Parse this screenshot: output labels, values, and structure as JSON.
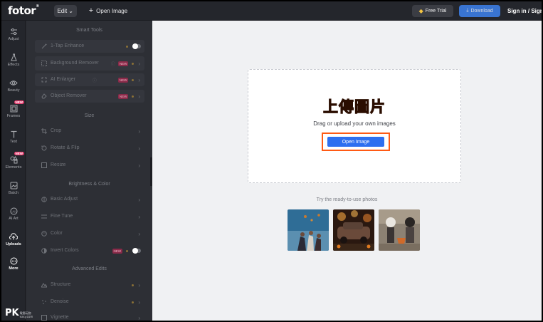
{
  "topbar": {
    "logo": "fotor",
    "logo_mark": "®",
    "edit_label": "Edit",
    "open_image_label": "Open Image",
    "free_trial_label": "Free Trial",
    "download_label": "Download",
    "signin_label": "Sign in / Sign up"
  },
  "rail": [
    {
      "label": "Adjust",
      "icon": "sliders-icon"
    },
    {
      "label": "Effects",
      "icon": "flask-icon"
    },
    {
      "label": "Beauty",
      "icon": "eye-icon"
    },
    {
      "label": "Frames",
      "icon": "frame-icon",
      "badge": "NEW"
    },
    {
      "label": "Text",
      "icon": "text-icon"
    },
    {
      "label": "Elements",
      "icon": "elements-icon",
      "badge": "NEW"
    },
    {
      "label": "Batch",
      "icon": "batch-icon"
    },
    {
      "label": "AI Art",
      "icon": "ai-icon"
    },
    {
      "label": "Uploads",
      "icon": "cloud-upload-icon"
    },
    {
      "label": "More",
      "icon": "more-icon"
    }
  ],
  "panel": {
    "sections": {
      "smart": "Smart Tools",
      "size": "Size",
      "brightness": "Brightness & Color",
      "advanced": "Advanced Edits"
    },
    "tools": {
      "one_tap": "1-Tap Enhance",
      "bg_remover": "Background Remover",
      "ai_enlarger": "AI Enlarger",
      "object_remover": "Object Remover",
      "crop": "Crop",
      "rotate": "Rotate & Flip",
      "resize": "Resize",
      "basic_adjust": "Basic Adjust",
      "fine_tune": "Fine Tune",
      "color": "Color",
      "invert": "Invert Colors",
      "structure": "Structure",
      "denoise": "Denoise",
      "vignette": "Vignette"
    },
    "new_badge": "NEW"
  },
  "canvas": {
    "upload_cn": "上傳圖片",
    "drag_text": "Drag or upload your own images",
    "open_button": "Open Image",
    "try_text": "Try the ready-to-use photos"
  },
  "watermark": {
    "logo": "PK",
    "line1": "電腦玩物",
    "line2": "easy.com"
  },
  "colors": {
    "accent_blue": "#2d6ff0",
    "highlight_orange": "#ff5a14",
    "new_badge": "#e3386b"
  }
}
